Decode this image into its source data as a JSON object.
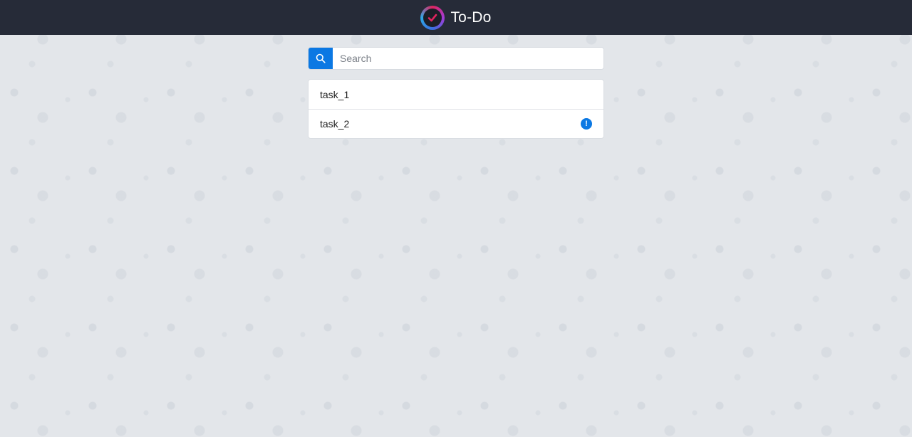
{
  "header": {
    "title": "To-Do",
    "logo_icon": "checkmark-logo-icon"
  },
  "search": {
    "placeholder": "Search",
    "value": "",
    "button_icon": "search-icon",
    "accent": "#0b78e3"
  },
  "tasks": [
    {
      "label": "task_1",
      "important": false
    },
    {
      "label": "task_2",
      "important": true,
      "badge": "!"
    }
  ],
  "colors": {
    "topbar": "#262b38",
    "background": "#e3e6ea",
    "accent": "#0b78e3"
  }
}
